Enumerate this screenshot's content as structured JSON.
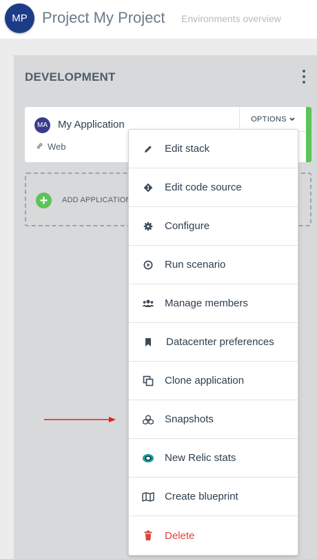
{
  "header": {
    "avatar_initials": "MP",
    "project_title": "Project My Project",
    "subtitle": "Environments overview"
  },
  "environment": {
    "title": "DEVELOPMENT",
    "application": {
      "avatar_initials": "MA",
      "name": "My Application",
      "link_label": "Web",
      "options_label": "OPTIONS",
      "status_color": "#5cc35a"
    },
    "add_application_label": "ADD APPLICATION"
  },
  "menu": {
    "items": [
      {
        "label": "Edit stack",
        "icon": "pencil-icon"
      },
      {
        "label": "Edit code source",
        "icon": "git-icon"
      },
      {
        "label": "Configure",
        "icon": "gear-icon"
      },
      {
        "label": "Run scenario",
        "icon": "play-circle-icon"
      },
      {
        "label": "Manage members",
        "icon": "users-icon"
      },
      {
        "label": "Datacenter preferences",
        "icon": "bookmark-icon"
      },
      {
        "label": "Clone application",
        "icon": "clone-icon"
      },
      {
        "label": "Snapshots",
        "icon": "cubes-icon"
      },
      {
        "label": "New Relic stats",
        "icon": "new-relic-icon"
      },
      {
        "label": "Create blueprint",
        "icon": "map-icon"
      },
      {
        "label": "Delete",
        "icon": "trash-icon"
      }
    ]
  },
  "colors": {
    "brand": "#1d3c87",
    "success": "#5cc35a",
    "danger": "#d9453c",
    "annotation_arrow": "#e02020"
  }
}
